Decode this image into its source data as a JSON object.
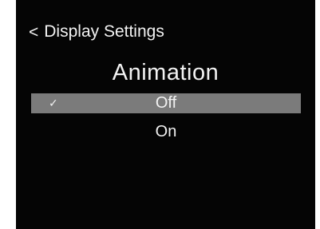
{
  "header": {
    "back_icon": "<",
    "label": "Display Settings"
  },
  "screen_title": "Animation",
  "options": [
    {
      "label": "Off",
      "selected": true,
      "check_icon": "✓"
    },
    {
      "label": "On",
      "selected": false
    }
  ],
  "colors": {
    "background": "#050505",
    "selected_row": "#7b7b7b",
    "text": "#f2f2f2"
  },
  "icons": {
    "back": "chevron-left-icon",
    "selected": "check-icon"
  }
}
